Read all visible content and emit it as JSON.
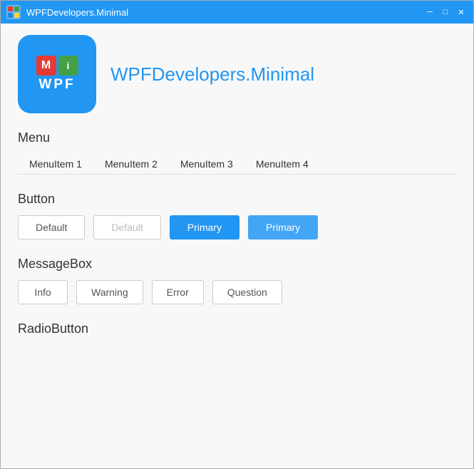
{
  "titlebar": {
    "title": "WPFDevelopers.Minimal",
    "controls": {
      "minimize": "─",
      "maximize": "□",
      "close": "✕"
    }
  },
  "header": {
    "app_name": "WPFDevelopers.Minimal"
  },
  "menu": {
    "label": "Menu",
    "items": [
      {
        "label": "MenuItem 1"
      },
      {
        "label": "MenuItem 2"
      },
      {
        "label": "MenuItem 3"
      },
      {
        "label": "MenuItem 4"
      }
    ]
  },
  "button_section": {
    "label": "Button",
    "buttons": [
      {
        "label": "Default",
        "style": "default"
      },
      {
        "label": "Default",
        "style": "default-disabled"
      },
      {
        "label": "Primary",
        "style": "primary"
      },
      {
        "label": "Primary",
        "style": "primary-hover"
      }
    ]
  },
  "messagebox_section": {
    "label": "MessageBox",
    "buttons": [
      {
        "label": "Info"
      },
      {
        "label": "Warning"
      },
      {
        "label": "Error"
      },
      {
        "label": "Question"
      }
    ]
  },
  "radiobutton_section": {
    "label": "RadioButton"
  }
}
